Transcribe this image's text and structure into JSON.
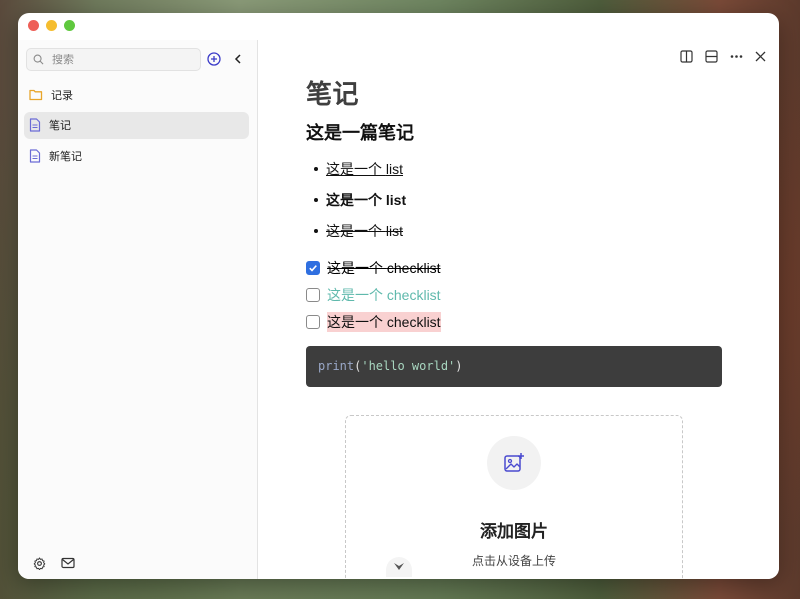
{
  "sidebar": {
    "search_placeholder": "搜索",
    "items": [
      {
        "label": "记录",
        "icon": "folder-icon"
      },
      {
        "label": "笔记",
        "icon": "document-icon",
        "active": true
      },
      {
        "label": "新笔记",
        "icon": "document-icon"
      }
    ]
  },
  "editor": {
    "doc_title": "笔记",
    "heading": "这是一篇笔记",
    "bullets": [
      {
        "prefix": "这是一个 ",
        "text": "list",
        "style": "underline"
      },
      {
        "prefix": "这是一个 ",
        "text": "list",
        "style": "bold"
      },
      {
        "prefix": "这是一个 ",
        "text": "list",
        "style": "strikethrough"
      }
    ],
    "checklist": [
      {
        "prefix": "这是一个 ",
        "text": "checklist",
        "checked": true,
        "style": "strikethrough"
      },
      {
        "prefix": "这是一个 ",
        "text": "checklist",
        "checked": false,
        "style": "teal"
      },
      {
        "prefix": "这是一个 ",
        "text": "checklist",
        "checked": false,
        "style": "highlight"
      }
    ],
    "code": {
      "fn": "print",
      "open": "(",
      "str": "'hello world'",
      "close": ")"
    },
    "upload": {
      "title": "添加图片",
      "subtitle": "点击从设备上传"
    }
  },
  "colors": {
    "accent": "#2f6fe0",
    "teal_text": "#5fb9ac",
    "highlight": "#f9d1d1",
    "code_bg": "#3d3d3d"
  }
}
